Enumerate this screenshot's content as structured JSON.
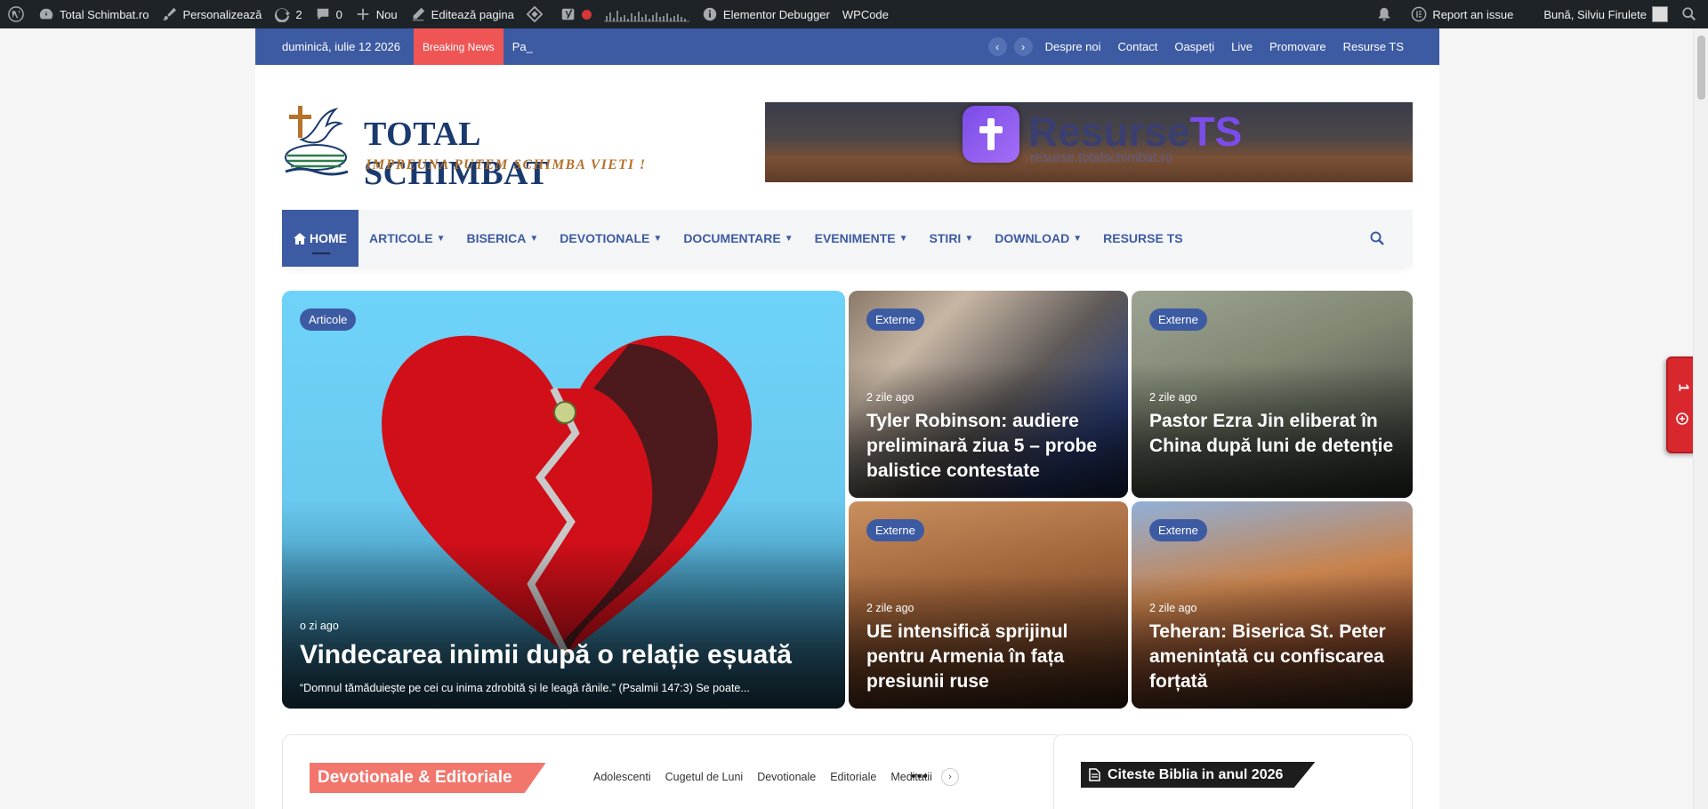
{
  "adminbar": {
    "site": "Total Schimbat.ro",
    "customize": "Personalizează",
    "updates": "2",
    "comments": "0",
    "new": "Nou",
    "edit_page": "Editează pagina",
    "elementor_debugger": "Elementor Debugger",
    "wpcode": "WPCode",
    "report": "Report an issue",
    "greeting": "Bună, Silviu Firulete"
  },
  "topbar": {
    "date": "duminică, iulie 12 2026",
    "breaking_label": "Breaking News",
    "ticker": "Pa_",
    "links": [
      "Despre noi",
      "Contact",
      "Oaspeți",
      "Live",
      "Promovare",
      "Resurse TS"
    ]
  },
  "logo": {
    "brand": "TOTAL SCHIMBAT",
    "tagline": "IMPREUNA PUTEM SCHIMBA VIETI !"
  },
  "banner": {
    "title_a": "Resurse",
    "title_b": "TS",
    "url": "resurse.totalschimbat.ro"
  },
  "nav": {
    "home": "HOME",
    "items": [
      "ARTICOLE",
      "BISERICA",
      "DEVOTIONALE",
      "DOCUMENTARE",
      "EVENIMENTE",
      "STIRI",
      "DOWNLOAD",
      "RESURSE TS"
    ]
  },
  "featured": {
    "main": {
      "category": "Articole",
      "ago": "o zi ago",
      "title": "Vindecarea inimii după o relație eșuată",
      "excerpt": "“Domnul tămăduiește pe cei cu inima zdrobită și le leagă rănile.” (Psalmii 147:3) Se poate..."
    },
    "cards": [
      {
        "category": "Externe",
        "ago": "2 zile ago",
        "title": "Tyler Robinson: audiere preliminară ziua 5 – probe balistice contestate"
      },
      {
        "category": "Externe",
        "ago": "2 zile ago",
        "title": "Pastor Ezra Jin eliberat în China după luni de detenție"
      },
      {
        "category": "Externe",
        "ago": "2 zile ago",
        "title": "UE intensifică sprijinul pentru Armenia în fața presiunii ruse"
      },
      {
        "category": "Externe",
        "ago": "2 zile ago",
        "title": "Teheran: Biserica St. Peter amenințată cu confiscarea forțată"
      }
    ]
  },
  "devotionale": {
    "title": "Devotionale & Editoriale",
    "tabs": [
      "Adolescenti",
      "Cugetul de Luni",
      "Devotionale",
      "Editoriale",
      "Meditatii"
    ],
    "more": "•••"
  },
  "sidebar": {
    "title": "Citeste Biblia in anul 2026"
  },
  "float_tab": {
    "count": "1"
  },
  "colors": {
    "brand_blue": "#3d5ba3",
    "breaking_red": "#f05555",
    "section_coral": "#f2766c",
    "admin_bar": "#1d2327"
  }
}
